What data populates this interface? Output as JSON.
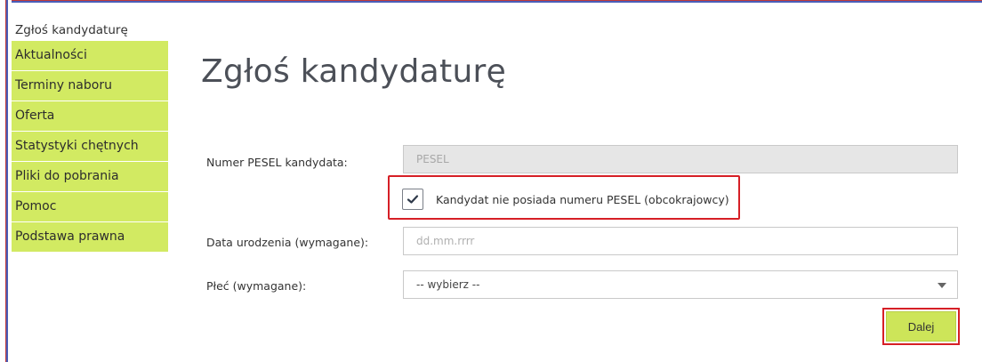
{
  "sidebar": {
    "header": "Zgłoś kandydaturę",
    "items": [
      {
        "label": "Aktualności"
      },
      {
        "label": "Terminy naboru"
      },
      {
        "label": "Oferta"
      },
      {
        "label": "Statystyki chętnych"
      },
      {
        "label": "Pliki do pobrania"
      },
      {
        "label": "Pomoc"
      },
      {
        "label": "Podstawa prawna"
      }
    ]
  },
  "main": {
    "title": "Zgłoś kandydaturę",
    "pesel": {
      "label": "Numer PESEL kandydata:",
      "placeholder": "PESEL"
    },
    "no_pesel": {
      "label": "Kandydat nie posiada numeru PESEL (obcokrajowcy)",
      "checked": true
    },
    "birth_date": {
      "label": "Data urodzenia (wymagane):",
      "placeholder": "dd.mm.rrrr"
    },
    "gender": {
      "label": "Płeć (wymagane):",
      "selected": "-- wybierz --"
    },
    "next_button": "Dalej"
  },
  "colors": {
    "sidebar_bg": "#d2ea62",
    "button_bg": "#cde559",
    "highlight": "#d61f26",
    "title": "#4c5058"
  },
  "icons": {
    "checkbox_mark": "check-icon",
    "select_arrow": "caret-down-icon"
  }
}
